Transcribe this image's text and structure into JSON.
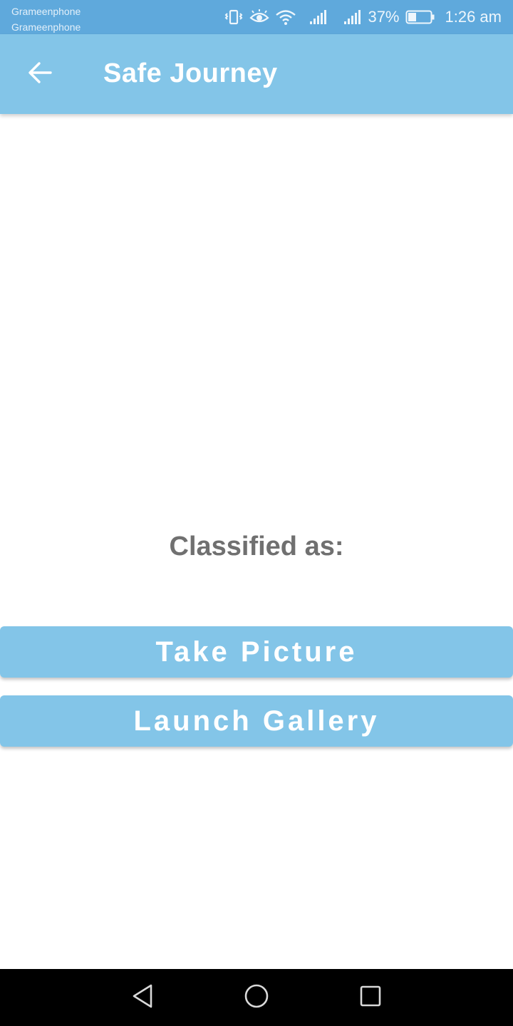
{
  "status_bar": {
    "carrier_1": "Grameenphone",
    "carrier_2": "Grameenphone",
    "battery_percent": "37%",
    "battery_level": 0.37,
    "time": "1:26 am",
    "icons": [
      "vibrate-icon",
      "eye-icon",
      "wifi-icon",
      "signal-icon",
      "signal-icon",
      "battery-icon"
    ]
  },
  "app_bar": {
    "title": "Safe Journey",
    "back_icon": "arrow-left-icon"
  },
  "main": {
    "classified_label": "Classified as:",
    "take_picture_label": "Take Picture",
    "launch_gallery_label": "Launch Gallery"
  },
  "nav_bar": {
    "icons": [
      "back-triangle-icon",
      "home-circle-icon",
      "recents-square-icon"
    ]
  },
  "colors": {
    "status_bar": "#5fa9dc",
    "accent": "#83c5e8",
    "label_text": "#707070",
    "nav_bar": "#000000"
  }
}
